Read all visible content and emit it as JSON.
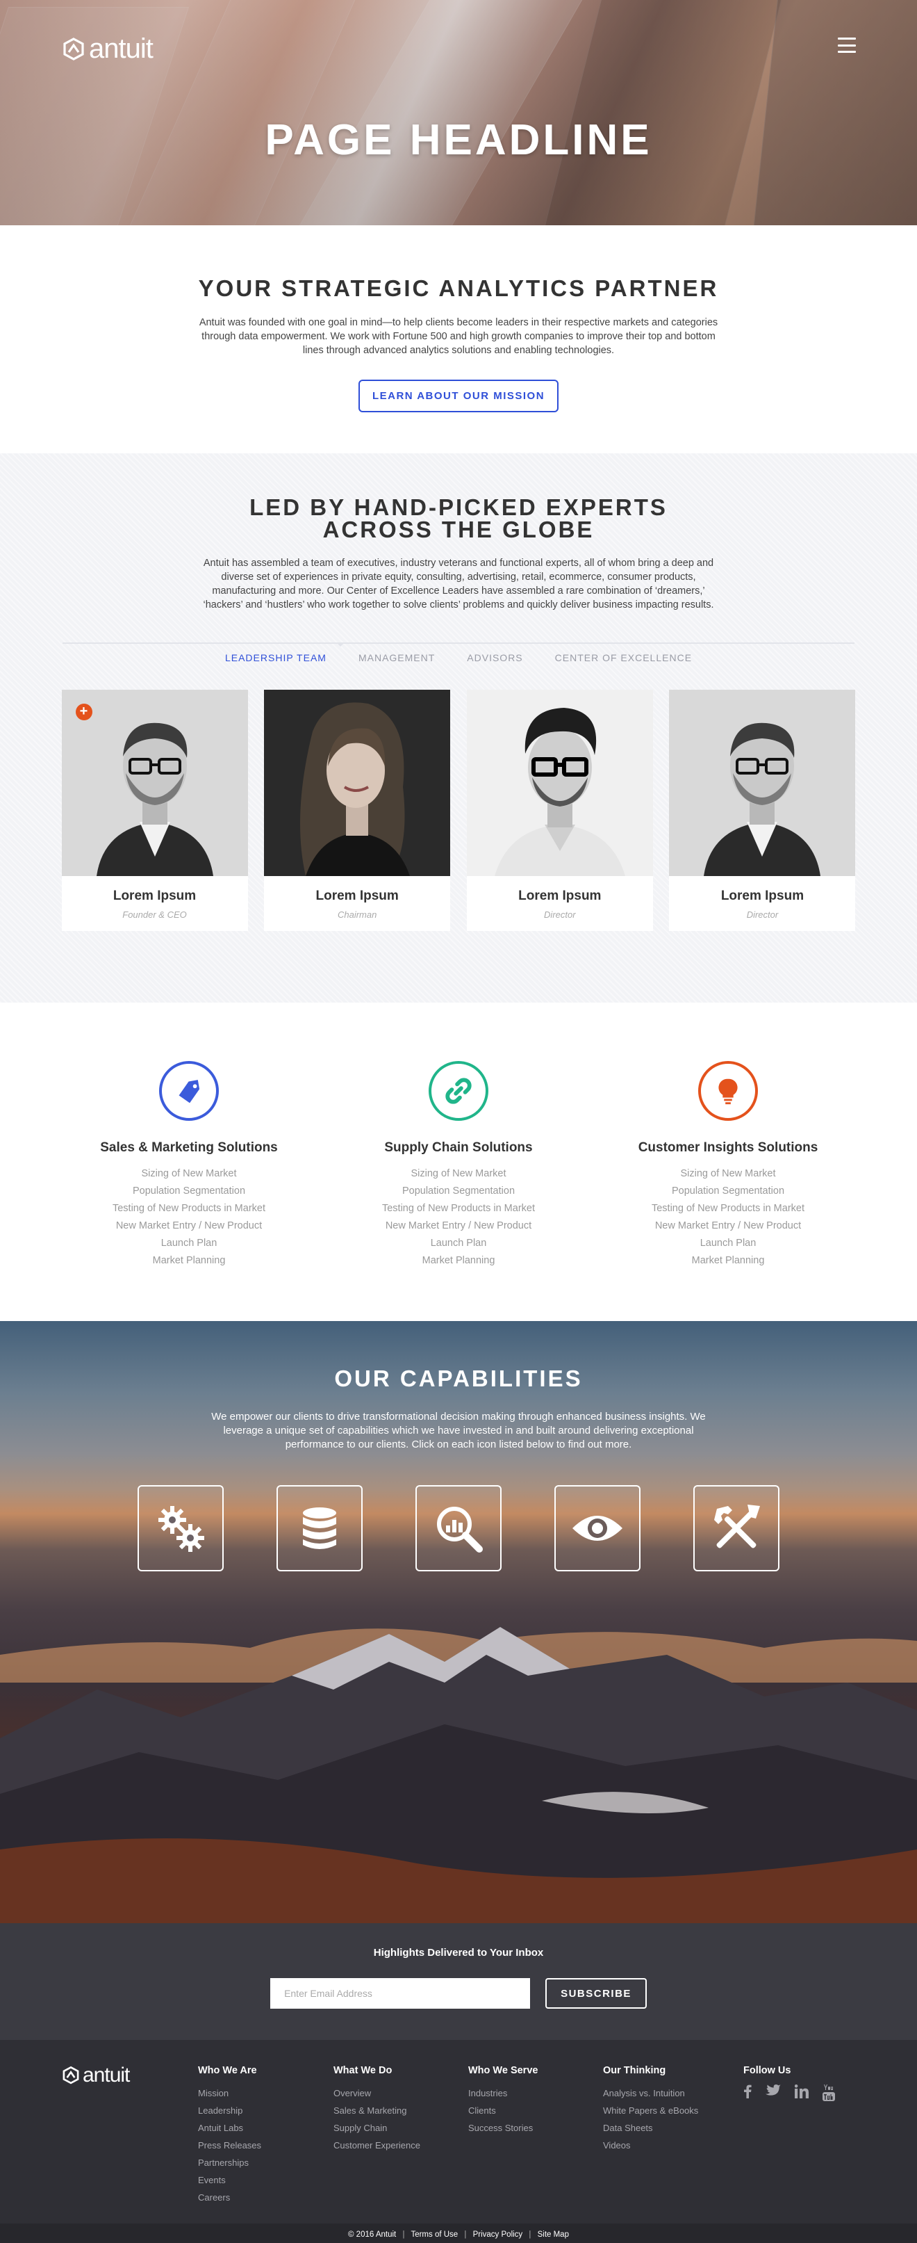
{
  "brand": {
    "name": "antuit"
  },
  "hero": {
    "headline": "PAGE HEADLINE"
  },
  "partner": {
    "title": "YOUR STRATEGIC ANALYTICS PARTNER",
    "body": "Antuit was founded with one goal in mind—to help clients become leaders in their respective markets and categories through data empowerment. We work with Fortune 500 and high growth companies to improve their top and bottom lines through advanced analytics solutions and enabling technologies.",
    "button": "LEARN ABOUT OUR MISSION"
  },
  "experts": {
    "title_line1": "LED BY HAND-PICKED EXPERTS",
    "title_line2": "ACROSS THE GLOBE",
    "body": "Antuit has assembled a team of executives, industry veterans and functional experts, all of whom bring a deep and diverse set of experiences in private equity, consulting, advertising, retail, ecommerce, consumer products, manufacturing and more.  Our Center of Excellence Leaders have assembled a rare combination of ‘dreamers,’ ‘hackers’ and ‘hustlers’ who work together to solve clients’ problems and quickly deliver business impacting results.",
    "tabs": [
      "LEADERSHIP TEAM",
      "MANAGEMENT",
      "ADVISORS",
      "CENTER OF EXCELLENCE"
    ],
    "team": [
      {
        "name": "Lorem Ipsum",
        "role": "Founder & CEO"
      },
      {
        "name": "Lorem Ipsum",
        "role": "Chairman"
      },
      {
        "name": "Lorem Ipsum",
        "role": "Director"
      },
      {
        "name": "Lorem Ipsum",
        "role": "Director"
      }
    ],
    "plus_label": "+"
  },
  "solutions": [
    {
      "title": "Sales & Marketing Solutions",
      "icon": "tag-icon",
      "color": "#3b5bdb",
      "items": [
        "Sizing of New Market",
        "Population Segmentation",
        "Testing of New Products in Market",
        "New Market Entry / New Product",
        "Launch Plan",
        "Market Planning"
      ]
    },
    {
      "title": "Supply Chain Solutions",
      "icon": "link-icon",
      "color": "#20b58a",
      "items": [
        "Sizing of New Market",
        "Population Segmentation",
        "Testing of New Products in Market",
        "New Market Entry / New Product",
        "Launch Plan",
        "Market Planning"
      ]
    },
    {
      "title": "Customer Insights Solutions",
      "icon": "lightbulb-icon",
      "color": "#e4521c",
      "items": [
        "Sizing of New Market",
        "Population Segmentation",
        "Testing of New Products in Market",
        "New Market Entry / New Product",
        "Launch Plan",
        "Market Planning"
      ]
    }
  ],
  "capabilities": {
    "title": "OUR CAPABILITIES",
    "body": "We empower our clients to drive transformational decision making through enhanced business insights. We leverage a unique set of capabilities which we have invested in and built around delivering exceptional performance to our clients. Click on each icon listed below to find out more.",
    "icons": [
      "gears-icon",
      "database-icon",
      "analytics-search-icon",
      "eye-icon",
      "tools-icon"
    ]
  },
  "newsletter": {
    "title": "Highlights Delivered to Your Inbox",
    "placeholder": "Enter Email Address",
    "button": "SUBSCRIBE"
  },
  "footer": {
    "columns": [
      {
        "title": "Who We Are",
        "links": [
          "Mission",
          "Leadership",
          "Antuit Labs",
          "Press Releases",
          "Partnerships",
          "Events",
          "Careers"
        ]
      },
      {
        "title": "What We Do",
        "links": [
          "Overview",
          "Sales & Marketing",
          "Supply Chain",
          "Customer Experience"
        ]
      },
      {
        "title": "Who We Serve",
        "links": [
          "Industries",
          "Clients",
          "Success Stories"
        ]
      },
      {
        "title": "Our Thinking",
        "links": [
          "Analysis vs. Intuition",
          "White Papers & eBooks",
          "Data Sheets",
          "Videos"
        ]
      }
    ],
    "follow_title": "Follow Us",
    "social": [
      "facebook-icon",
      "twitter-icon",
      "linkedin-icon",
      "youtube-icon"
    ],
    "copyright": "© 2016 Antuit",
    "bottom_links": [
      "Terms of Use",
      "Privacy Policy",
      "Site Map"
    ]
  }
}
